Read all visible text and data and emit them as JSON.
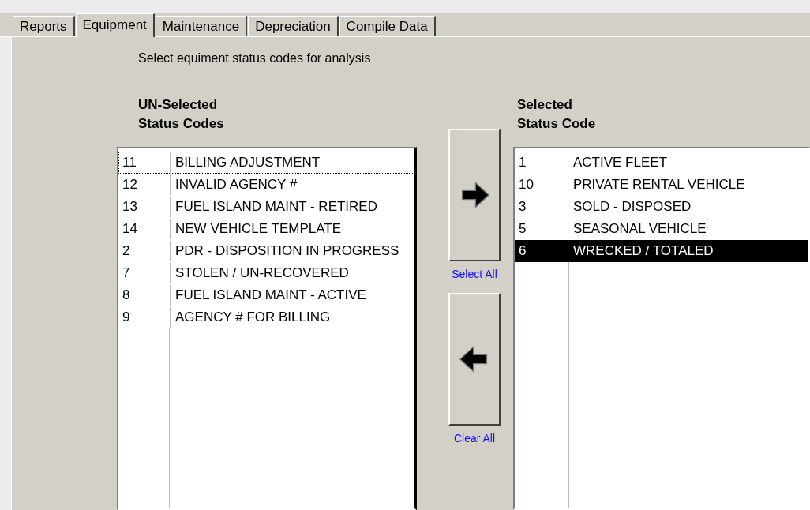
{
  "tabs": [
    {
      "label": "Reports",
      "selected": false
    },
    {
      "label": "Equipment",
      "selected": true
    },
    {
      "label": "Maintenance",
      "selected": false
    },
    {
      "label": "Depreciation",
      "selected": false
    },
    {
      "label": "Compile Data",
      "selected": false
    }
  ],
  "instruction": "Select equiment status codes for analysis",
  "unselected_list": {
    "heading": [
      "UN-Selected",
      "Status Codes"
    ],
    "rows": [
      {
        "code": "11",
        "description": "BILLING ADJUSTMENT",
        "selected": false,
        "focused": true
      },
      {
        "code": "12",
        "description": "INVALID AGENCY #",
        "selected": false,
        "focused": false
      },
      {
        "code": "13",
        "description": "FUEL ISLAND MAINT - RETIRED",
        "selected": false,
        "focused": false
      },
      {
        "code": "14",
        "description": "NEW VEHICLE TEMPLATE",
        "selected": false,
        "focused": false
      },
      {
        "code": "2",
        "description": "PDR - DISPOSITION IN PROGRESS",
        "selected": false,
        "focused": false
      },
      {
        "code": "7",
        "description": "STOLEN / UN-RECOVERED",
        "selected": false,
        "focused": false
      },
      {
        "code": "8",
        "description": "FUEL ISLAND MAINT - ACTIVE",
        "selected": false,
        "focused": false
      },
      {
        "code": "9",
        "description": "AGENCY # FOR BILLING",
        "selected": false,
        "focused": false
      }
    ]
  },
  "move_buttons": [
    {
      "kind": "right",
      "link": "Select All"
    },
    {
      "kind": "left",
      "link": "Clear All"
    }
  ],
  "selected_list": {
    "heading": [
      "Selected",
      "Status Code"
    ],
    "rows": [
      {
        "code": "1",
        "description": "ACTIVE FLEET",
        "selected": false,
        "focused": false
      },
      {
        "code": "10",
        "description": "PRIVATE RENTAL VEHICLE",
        "selected": false,
        "focused": false
      },
      {
        "code": "3",
        "description": "SOLD - DISPOSED",
        "selected": false,
        "focused": false
      },
      {
        "code": "5",
        "description": "SEASONAL VEHICLE",
        "selected": false,
        "focused": false
      },
      {
        "code": "6",
        "description": "WRECKED / TOTALED",
        "selected": true,
        "focused": false
      }
    ]
  }
}
